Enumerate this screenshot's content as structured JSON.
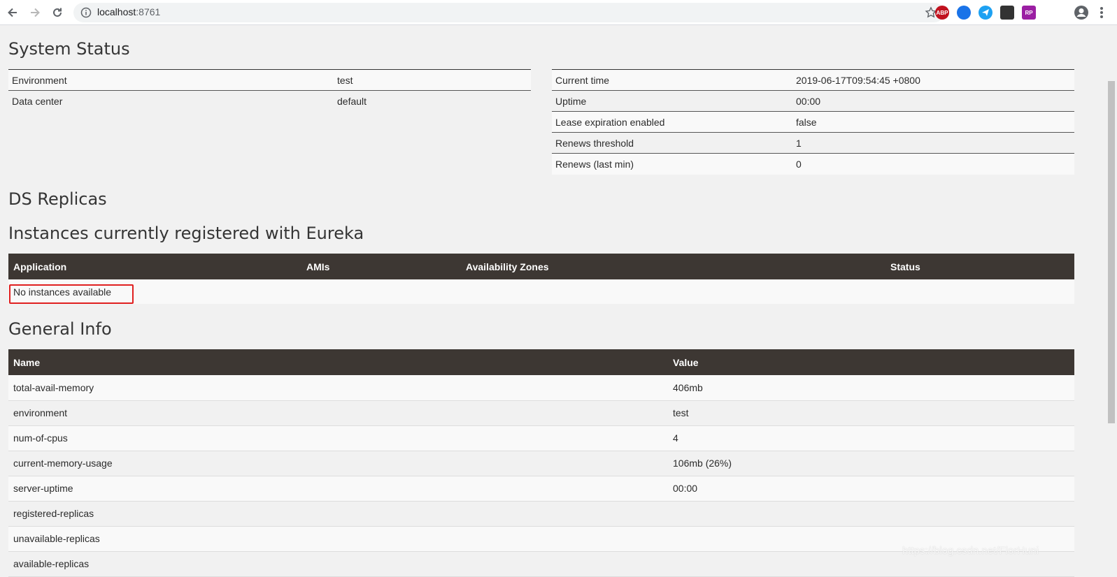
{
  "browser": {
    "url_host": "localhost",
    "url_port": ":8761",
    "extensions": [
      {
        "name": "adblock",
        "label": "ABP",
        "color": "#c1121f"
      },
      {
        "name": "globe",
        "label": "",
        "color": "#1a73e8"
      },
      {
        "name": "paper-plane",
        "label": "",
        "color": "#1da1f2"
      },
      {
        "name": "ghost",
        "label": "",
        "color": "#333333"
      },
      {
        "name": "rp",
        "label": "RP",
        "color": "#9b1fa3"
      }
    ]
  },
  "system_status": {
    "title": "System Status",
    "left": [
      {
        "key": "Environment",
        "value": "test"
      },
      {
        "key": "Data center",
        "value": "default"
      }
    ],
    "right": [
      {
        "key": "Current time",
        "value": "2019-06-17T09:54:45 +0800"
      },
      {
        "key": "Uptime",
        "value": "00:00"
      },
      {
        "key": "Lease expiration enabled",
        "value": "false"
      },
      {
        "key": "Renews threshold",
        "value": "1"
      },
      {
        "key": "Renews (last min)",
        "value": "0"
      }
    ]
  },
  "ds_replicas": {
    "title": "DS Replicas"
  },
  "instances": {
    "title": "Instances currently registered with Eureka",
    "headers": [
      "Application",
      "AMIs",
      "Availability Zones",
      "Status"
    ],
    "empty_text": "No instances available"
  },
  "general_info": {
    "title": "General Info",
    "headers": [
      "Name",
      "Value"
    ],
    "rows": [
      {
        "name": "total-avail-memory",
        "value": "406mb"
      },
      {
        "name": "environment",
        "value": "test"
      },
      {
        "name": "num-of-cpus",
        "value": "4"
      },
      {
        "name": "current-memory-usage",
        "value": "106mb (26%)"
      },
      {
        "name": "server-uptime",
        "value": "00:00"
      },
      {
        "name": "registered-replicas",
        "value": ""
      },
      {
        "name": "unavailable-replicas",
        "value": ""
      },
      {
        "name": "available-replicas",
        "value": ""
      }
    ]
  },
  "watermark": "https://blog.csdn.net/FlorHuni",
  "colors": {
    "header_bg": "#3d3733",
    "highlight": "#e02020",
    "page_bg": "#f1f1f1"
  }
}
